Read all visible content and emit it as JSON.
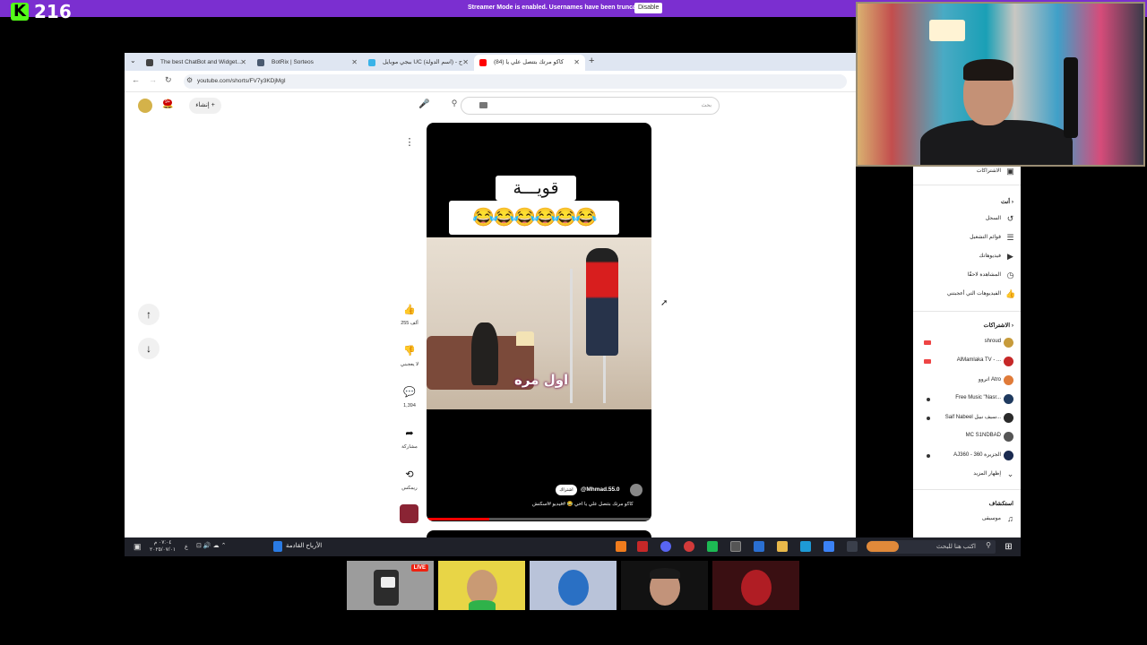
{
  "stream": {
    "viewer_count": "216",
    "streamer_mode_message": "Streamer Mode is enabled. Usernames have been truncated.",
    "disable_label": "Disable",
    "accent": "#7b2fd0",
    "kick_green": "#53fc18"
  },
  "browser": {
    "tabs": [
      {
        "title": "The best ChatBot and Widget...",
        "favicon": "gear-icon"
      },
      {
        "title": "BotRix | Sorteos",
        "favicon": "bot-icon"
      },
      {
        "title": "ببجي موبايل UC (اسم الدولة) - ح",
        "favicon": "globe-icon"
      },
      {
        "title": "(84) كاكو مرتك بتتصل علي يا",
        "favicon": "youtube-icon"
      }
    ],
    "url": "youtube.com/shorts/FV7y3KDjMgI"
  },
  "youtube": {
    "search_placeholder": "بحث",
    "create_label": "إنشاء",
    "bell_badge": "9+",
    "short": {
      "caption_top": "قويـــة",
      "caption_emoji": "😂😂😂😂😂😂",
      "scene_caption": "اول مره",
      "channel": "@Mhmad.55.0",
      "subscribe": "اشتراك",
      "title": "كاكو مرتك بتتصل علي يا اخي 😂 #فيديو #اسكتش"
    },
    "actions": {
      "likes": "255 ألف",
      "dislike": "لا يعجبني",
      "comments": "1,394",
      "share": "مشاركة",
      "remix": "ريمكس"
    },
    "sidebar": {
      "top_item": "الاشتراكات",
      "you_heading": "أنت",
      "you_items": [
        {
          "label": "السجل",
          "icon": "history-icon"
        },
        {
          "label": "قوائم التشغيل",
          "icon": "playlist-icon"
        },
        {
          "label": "فيديوهاتك",
          "icon": "your-videos-icon"
        },
        {
          "label": "المشاهدة لاحقًا",
          "icon": "watch-later-icon"
        },
        {
          "label": "الفيديوهات التي أعجبتني",
          "icon": "liked-icon"
        }
      ],
      "subs_heading": "الاشتراكات",
      "subscriptions": [
        {
          "label": "shroud",
          "color": "#c79b3b",
          "indicator": "live"
        },
        {
          "label": "AlMamlaka TV - ...",
          "color": "#c62828",
          "indicator": "live"
        },
        {
          "label": "اتروو Atro",
          "color": "#e07b39",
          "indicator": ""
        },
        {
          "label": "Free Music \"Nasr...",
          "color": "#1f3a5f",
          "indicator": "dot"
        },
        {
          "label": "Saif Nabeel سيف نبيل...",
          "color": "#2a2a2a",
          "indicator": "dot"
        },
        {
          "label": "MC S1NDBAD",
          "color": "#555555",
          "indicator": ""
        },
        {
          "label": "AJ360 - الجزيرة 360",
          "color": "#1a2a50",
          "indicator": "dot"
        }
      ],
      "show_more": "إظهار المزيد",
      "explore_heading": "استكشاف",
      "explore_items": [
        {
          "label": "موسيقى",
          "icon": "music-icon"
        }
      ]
    }
  },
  "taskbar": {
    "search_text": "اكتب هنا للبحث",
    "news_label": "الأرباح القادمة",
    "time": "٠٧:٠٤ م",
    "date": "٢٠٢٥/٠٧/٠١",
    "lang": "ع"
  },
  "participants": {
    "live_badge": "LIVE"
  }
}
